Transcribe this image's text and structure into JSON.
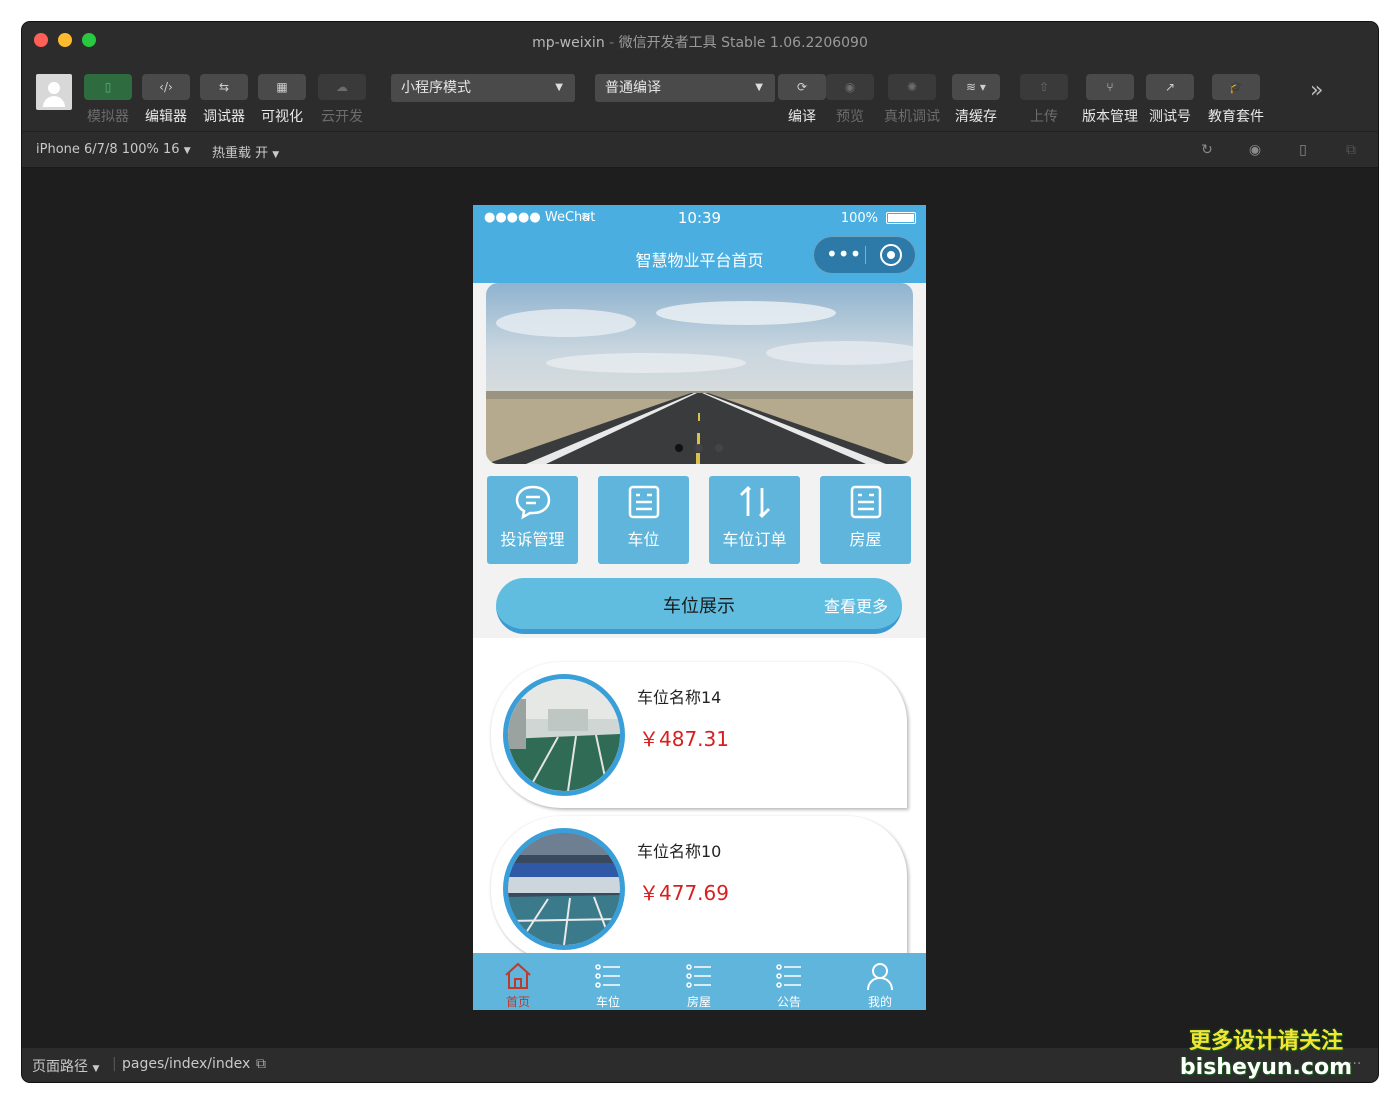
{
  "window": {
    "title": "mp-weixin",
    "subtitle": "微信开发者工具 Stable 1.06.2206090",
    "lights": [
      "#fe5f57",
      "#febb2e",
      "#28c840"
    ]
  },
  "toolbar": {
    "simulator": "模拟器",
    "editor": "编辑器",
    "debugger": "调试器",
    "visual": "可视化",
    "cloud": "云开发",
    "mode_select": "小程序模式",
    "compile_select": "普通编译",
    "compile": "编译",
    "preview": "预览",
    "device_debug": "真机调试",
    "clear_cache": "清缓存",
    "upload": "上传",
    "version": "版本管理",
    "test_account": "测试号",
    "edu": "教育套件",
    "editor_glyph": "‹/›"
  },
  "subbar": {
    "device": "iPhone 6/7/8 100% 16",
    "hot_reload": "热重载 开"
  },
  "statusbar": {
    "path_label": "页面路径",
    "path": "pages/index/index",
    "ellipsis": "···"
  },
  "phone": {
    "status": {
      "carrier": "●●●●● WeChat",
      "time": "10:39",
      "battery": "100%"
    },
    "nav_title": "智慧物业平台首页",
    "capsule_dots": "•••",
    "banner_dots": 3,
    "menu": [
      {
        "label": "投诉管理"
      },
      {
        "label": "车位"
      },
      {
        "label": "车位订单"
      },
      {
        "label": "房屋"
      }
    ],
    "section": {
      "title": "车位展示",
      "more": "查看更多"
    },
    "cards": [
      {
        "name": "车位名称14",
        "price": "￥487.31"
      },
      {
        "name": "车位名称10",
        "price": "￥477.69"
      }
    ],
    "tabs": [
      {
        "label": "首页"
      },
      {
        "label": "车位"
      },
      {
        "label": "房屋"
      },
      {
        "label": "公告"
      },
      {
        "label": "我的"
      }
    ]
  },
  "watermark": {
    "line1": "更多设计请关注",
    "line2": "bisheyun.com"
  }
}
